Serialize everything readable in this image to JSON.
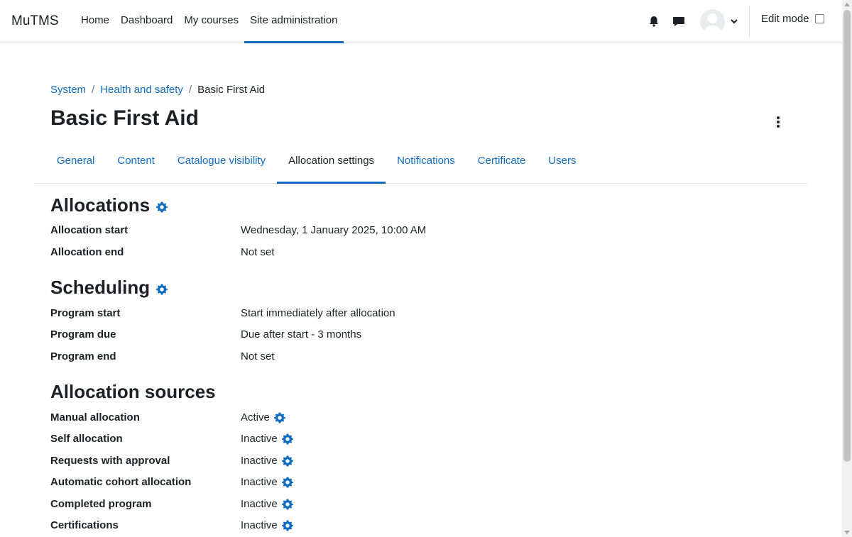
{
  "navbar": {
    "brand": "MuTMS",
    "links": [
      {
        "label": "Home"
      },
      {
        "label": "Dashboard"
      },
      {
        "label": "My courses"
      },
      {
        "label": "Site administration"
      }
    ],
    "active_link": "Site administration",
    "edit_mode_label": "Edit mode",
    "edit_mode_checked": false
  },
  "breadcrumb": {
    "items": [
      "System",
      "Health and safety"
    ],
    "separator": "/",
    "current": "Basic First Aid"
  },
  "page_title": "Basic First Aid",
  "tabs": [
    {
      "label": "General"
    },
    {
      "label": "Content"
    },
    {
      "label": "Catalogue visibility"
    },
    {
      "label": "Allocation settings"
    },
    {
      "label": "Notifications"
    },
    {
      "label": "Certificate"
    },
    {
      "label": "Users"
    }
  ],
  "active_tab": "Allocation settings",
  "allocations": {
    "title": "Allocations",
    "rows": [
      {
        "label": "Allocation start",
        "value": "Wednesday, 1 January 2025, 10:00 AM"
      },
      {
        "label": "Allocation end",
        "value": "Not set"
      }
    ]
  },
  "scheduling": {
    "title": "Scheduling",
    "rows": [
      {
        "label": "Program start",
        "value": "Start immediately after allocation"
      },
      {
        "label": "Program due",
        "value": "Due after start - 3 months"
      },
      {
        "label": "Program end",
        "value": "Not set"
      }
    ]
  },
  "sources": {
    "title": "Allocation sources",
    "rows": [
      {
        "label": "Manual allocation",
        "value": "Active"
      },
      {
        "label": "Self allocation",
        "value": "Inactive"
      },
      {
        "label": "Requests with approval",
        "value": "Inactive"
      },
      {
        "label": "Automatic cohort allocation",
        "value": "Inactive"
      },
      {
        "label": "Completed program",
        "value": "Inactive"
      },
      {
        "label": "Certifications",
        "value": "Inactive"
      }
    ]
  },
  "colors": {
    "link": "#0f6cbf",
    "text": "#1d2125",
    "border": "#dee2e6"
  }
}
